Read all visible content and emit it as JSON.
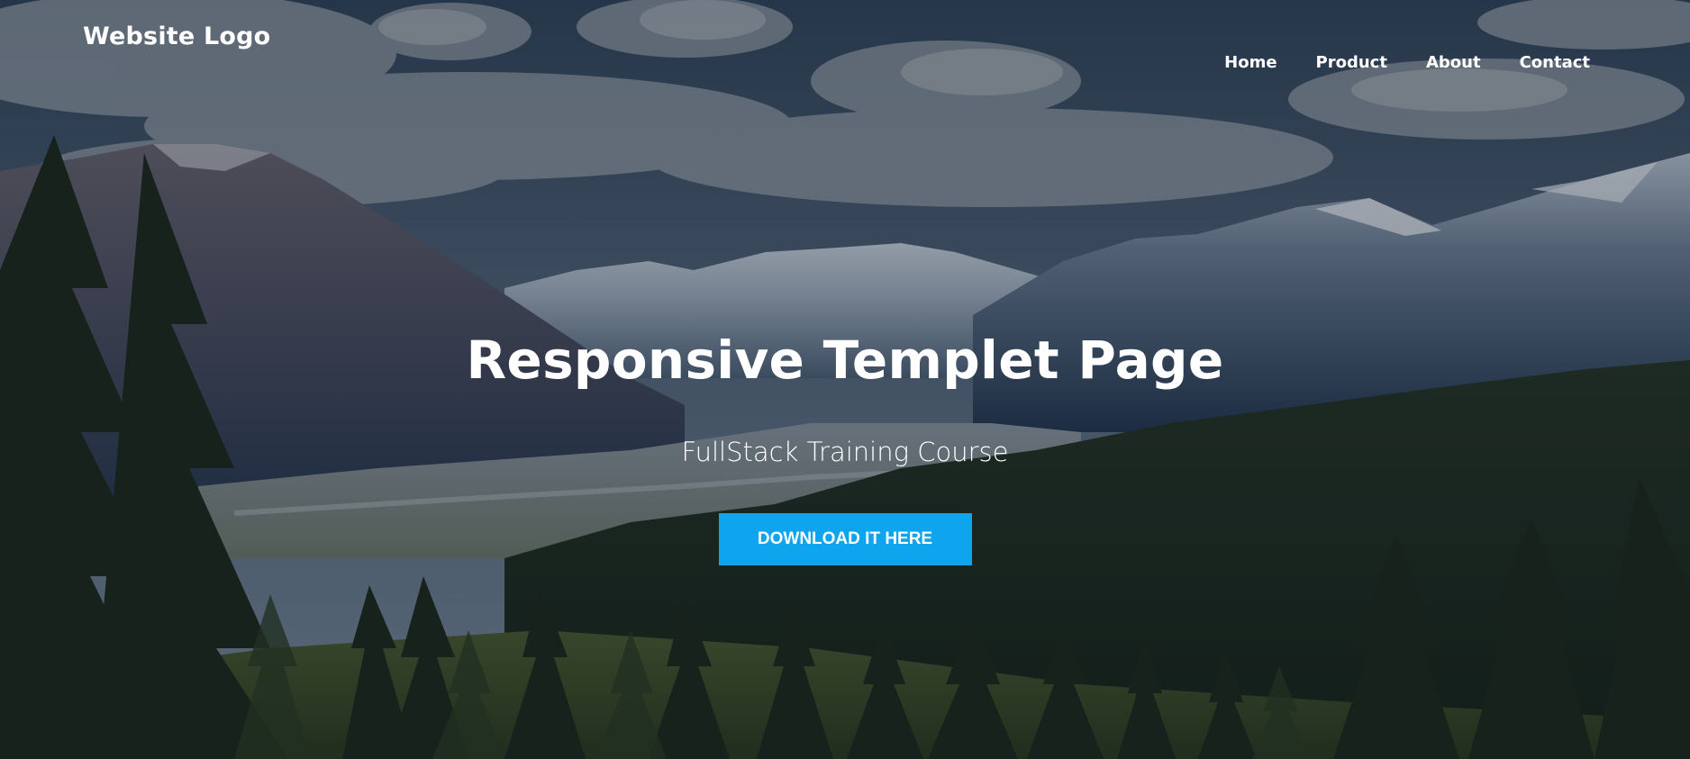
{
  "page": {
    "background": "mountain valley landscape with pine forest and cloudy sky"
  },
  "header": {
    "logo": "Website Logo",
    "nav": [
      {
        "label": "Home"
      },
      {
        "label": "Product"
      },
      {
        "label": "About"
      },
      {
        "label": "Contact"
      }
    ]
  },
  "hero": {
    "title": "Responsive Templet Page",
    "subtitle": "FullStack Training Course",
    "cta_label": "DOWNLOAD IT HERE"
  },
  "colors": {
    "accent": "#0ea4ee",
    "text": "#ffffff"
  }
}
